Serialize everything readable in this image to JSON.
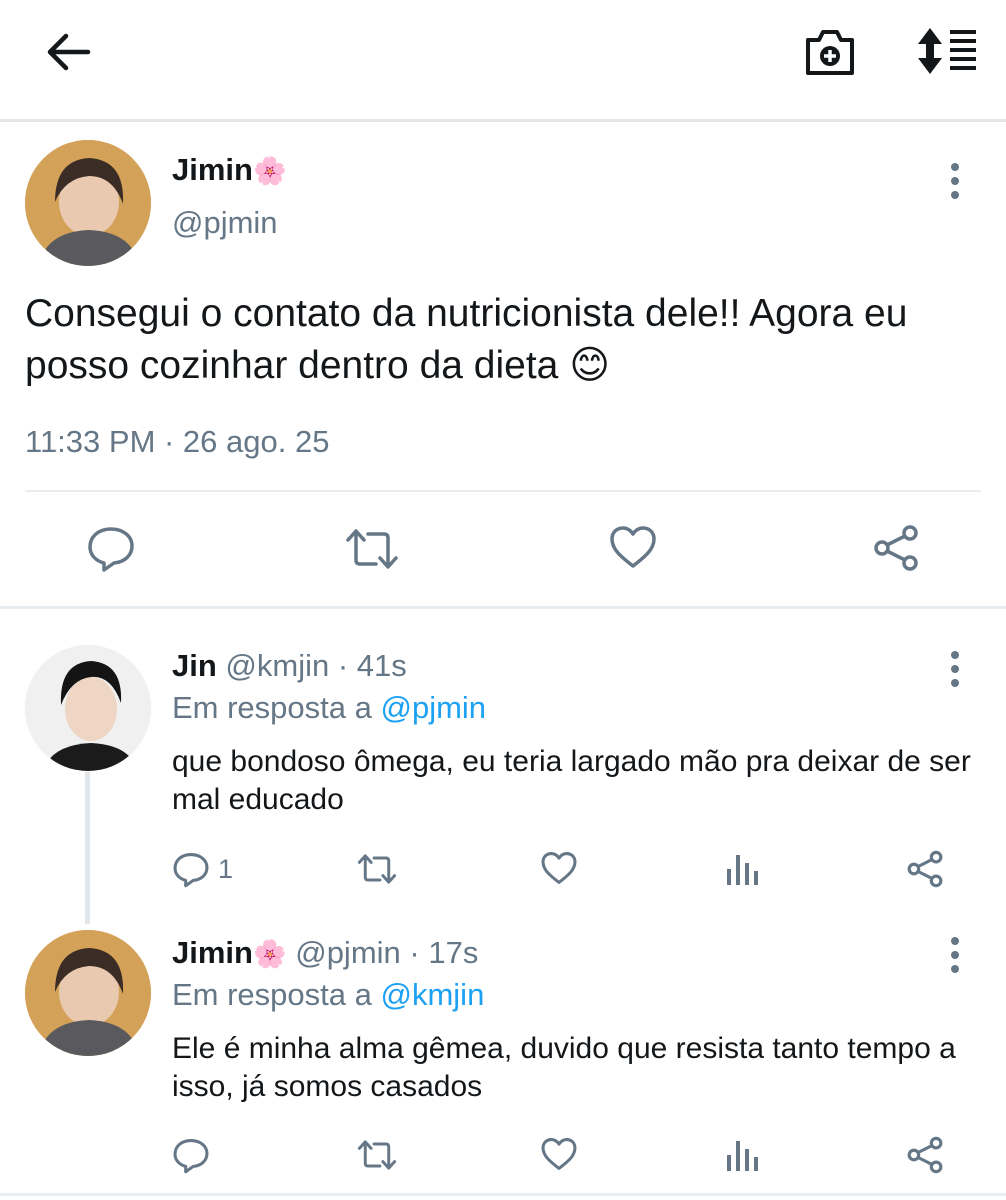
{
  "app": {
    "accent": "#1da1f2",
    "muted": "#657786",
    "text": "#14171a"
  },
  "topbar": {
    "back_icon": "arrow-left-icon",
    "camera_icon": "camera-plus-icon",
    "sort_icon": "sort-list-icon"
  },
  "main_tweet": {
    "name": "Jimin",
    "name_emoji": "🌸",
    "handle": "@pjmin",
    "text": "Consegui o contato da nutricionista dele!! Agora eu posso cozinhar dentro da dieta",
    "text_emoji": "😊",
    "timestamp": "11:33 PM · 26 ago. 25",
    "actions": [
      "reply-icon",
      "retweet-icon",
      "like-icon",
      "share-icon"
    ]
  },
  "replies": [
    {
      "name": "Jin",
      "name_emoji": "",
      "handle": "@kmjin",
      "time": "· 41s",
      "in_reply_label": "Em resposta a",
      "in_reply_to": "@pjmin",
      "text": "que bondoso ômega, eu teria largado mão pra deixar de ser mal educado",
      "reply_count": "1"
    },
    {
      "name": "Jimin",
      "name_emoji": "🌸",
      "handle": "@pjmin",
      "time": "· 17s",
      "in_reply_label": "Em resposta a",
      "in_reply_to": "@kmjin",
      "text": "Ele é minha alma gêmea, duvido que resista tanto tempo a isso, já somos casados",
      "reply_count": ""
    }
  ]
}
